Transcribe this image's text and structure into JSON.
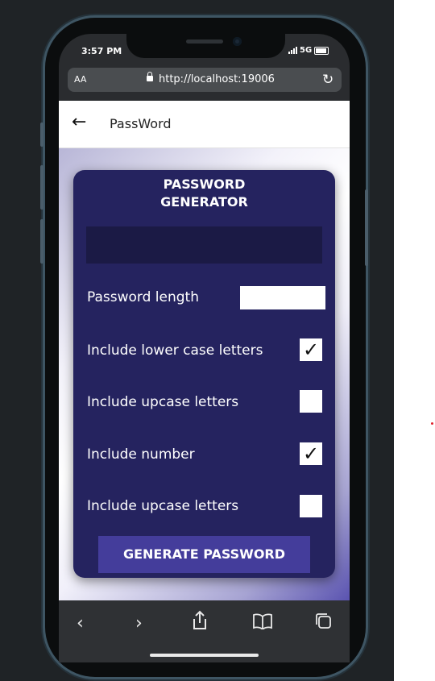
{
  "status": {
    "time": "3:57 PM",
    "network": "5G"
  },
  "browser": {
    "text_size_label": "AA",
    "url": "http://localhost:19006",
    "reload_icon": "reload-icon",
    "toolbar_icons": [
      "back-icon",
      "forward-icon",
      "share-icon",
      "bookmarks-icon",
      "tabs-icon"
    ]
  },
  "header": {
    "title": "PassWord",
    "back_icon": "left-arrow-icon"
  },
  "card": {
    "title_line1": "PASSWORD",
    "title_line2": "GENERATOR",
    "generated_password": "",
    "rows": [
      {
        "label": "Password length",
        "type": "input",
        "value": ""
      },
      {
        "label": "Include lower case letters",
        "type": "checkbox",
        "checked": true
      },
      {
        "label": "Include upcase letters",
        "type": "checkbox",
        "checked": false
      },
      {
        "label": "Include number",
        "type": "checkbox",
        "checked": true
      },
      {
        "label": "Include upcase letters",
        "type": "checkbox",
        "checked": false
      }
    ],
    "button_label": "GENERATE PASSWORD"
  },
  "colors": {
    "card": "#25235f",
    "button": "#443d9b",
    "output": "#1b1a45"
  }
}
